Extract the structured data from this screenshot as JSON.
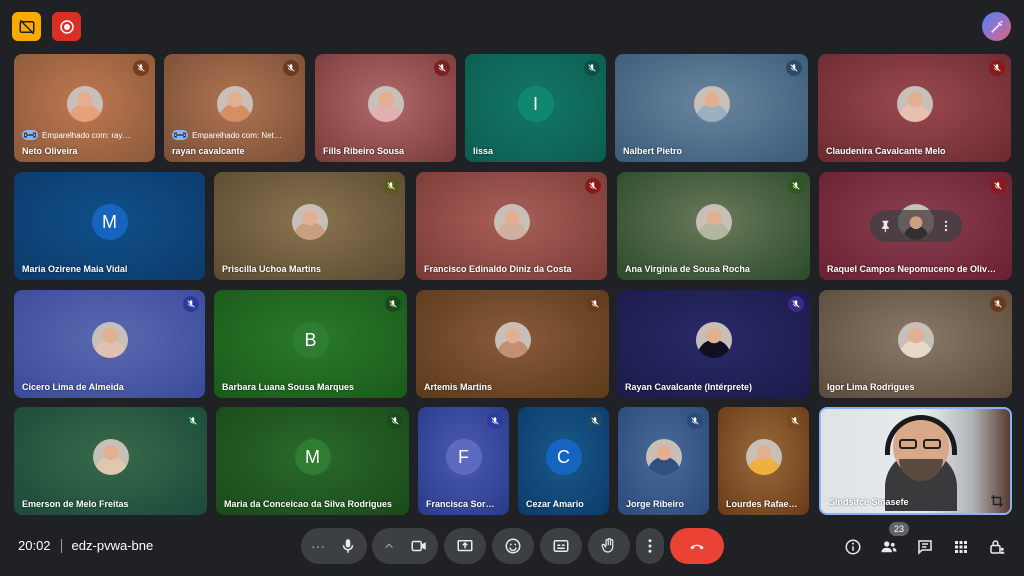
{
  "meeting": {
    "time": "20:02",
    "code": "edz-pvwa-bne",
    "participant_count": "23"
  },
  "participants": [
    {
      "name": "Neto Oliveira",
      "paired": "Emparelhado com: ray…"
    },
    {
      "name": "rayan cavalcante",
      "paired": "Emparelhado com: Net…"
    },
    {
      "name": "Fills Ribeiro Sousa"
    },
    {
      "name": "lissa",
      "initial": "I"
    },
    {
      "name": "Nalbert Pietro"
    },
    {
      "name": "Claudenira Cavalcante Melo"
    },
    {
      "name": "Maria Ozirene Maia Vidal",
      "initial": "M"
    },
    {
      "name": "Priscilla Uchoa Martins"
    },
    {
      "name": "Francisco Edinaldo Diniz da Costa"
    },
    {
      "name": "Ana Virginia de Sousa Rocha"
    },
    {
      "name": "Raquel Campos Nepomuceno de Oliv…"
    },
    {
      "name": "Cicero Lima de Almeida"
    },
    {
      "name": "Barbara Luana Sousa Marques",
      "initial": "B"
    },
    {
      "name": "Artemis Martins"
    },
    {
      "name": "Rayan Cavalcante (Intérprete)"
    },
    {
      "name": "Igor Lima Rodrigues"
    },
    {
      "name": "Emerson de Melo Freitas"
    },
    {
      "name": "Maria da Conceicao da Silva Rodrigues",
      "initial": "M"
    },
    {
      "name": "Francisca Sor…",
      "initial": "F"
    },
    {
      "name": "Cezar Amario",
      "initial": "C"
    },
    {
      "name": "Jorge Ribeiro"
    },
    {
      "name": "Lourdes Rafae…"
    },
    {
      "name": "Sindsifce Sinasefe"
    }
  ]
}
